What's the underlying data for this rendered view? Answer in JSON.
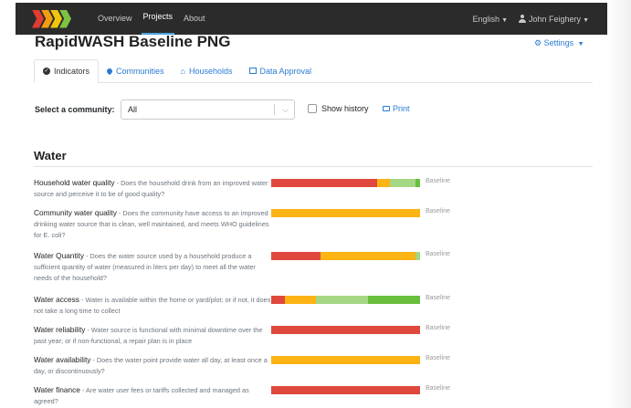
{
  "navbar": {
    "logo_colors": [
      "#e03c31",
      "#f39c12",
      "#f1c40f",
      "#7dc242"
    ],
    "links": [
      {
        "label": "Overview",
        "active": false
      },
      {
        "label": "Projects",
        "active": true
      },
      {
        "label": "About",
        "active": false
      }
    ],
    "language": "English",
    "user": "John Feighery"
  },
  "page": {
    "title": "RapidWASH Baseline PNG",
    "settings_label": "Settings"
  },
  "tabs": [
    {
      "label": "Indicators",
      "icon": "check-circle-icon",
      "active": true
    },
    {
      "label": "Communities",
      "icon": "map-marker-icon",
      "active": false
    },
    {
      "label": "Households",
      "icon": "home-icon",
      "active": false
    },
    {
      "label": "Data Approval",
      "icon": "table-icon",
      "active": false
    }
  ],
  "filter": {
    "label": "Select a community:",
    "value": "All",
    "show_history_label": "Show history",
    "show_history_checked": false,
    "print_label": "Print"
  },
  "section_title": "Water",
  "colors": {
    "red": "#e0483e",
    "orange": "#fcb314",
    "lightgreen": "#a6d785",
    "green": "#6abf3c"
  },
  "indicators": [
    {
      "name": "Household water quality",
      "description": "Does the household drink from an improved water source and perceive it to be of good quality?",
      "segments": [
        {
          "color": "red",
          "pct": 71
        },
        {
          "color": "orange",
          "pct": 9
        },
        {
          "color": "lightgreen",
          "pct": 17
        },
        {
          "color": "green",
          "pct": 3
        }
      ],
      "series": "Baseline"
    },
    {
      "name": "Community water quality",
      "description": "Does the community have access to an improved drinking water source that is clean, well maintained, and meets WHO guidelines for E. coli?",
      "segments": [
        {
          "color": "orange",
          "pct": 100
        }
      ],
      "series": "Baseline"
    },
    {
      "name": "Water Quantity",
      "description": "Does the water source used by a household produce a sufficient quantity of water (measured in liters per day) to meet all the water needs of the household?",
      "segments": [
        {
          "color": "red",
          "pct": 33
        },
        {
          "color": "orange",
          "pct": 64
        },
        {
          "color": "lightgreen",
          "pct": 3
        }
      ],
      "series": "Baseline"
    },
    {
      "name": "Water access",
      "description": "Water is available within the home or yard/plot; or if not, it does not take a long time to collect",
      "segments": [
        {
          "color": "red",
          "pct": 9
        },
        {
          "color": "orange",
          "pct": 21
        },
        {
          "color": "lightgreen",
          "pct": 35
        },
        {
          "color": "green",
          "pct": 35
        }
      ],
      "series": "Baseline"
    },
    {
      "name": "Water reliability",
      "description": "Water source is functional with minimal downtime over the past year; or if non-functional, a repair plan is in place",
      "segments": [
        {
          "color": "red",
          "pct": 100
        }
      ],
      "series": "Baseline"
    },
    {
      "name": "Water availability",
      "description": "Does the water point provide water all day, at least once a day, or discontinuously?",
      "segments": [
        {
          "color": "orange",
          "pct": 100
        }
      ],
      "series": "Baseline"
    },
    {
      "name": "Water finance",
      "description": "Are water user fees or tariffs collected and managed as agreed?",
      "segments": [
        {
          "color": "red",
          "pct": 100
        }
      ],
      "series": "Baseline"
    }
  ]
}
